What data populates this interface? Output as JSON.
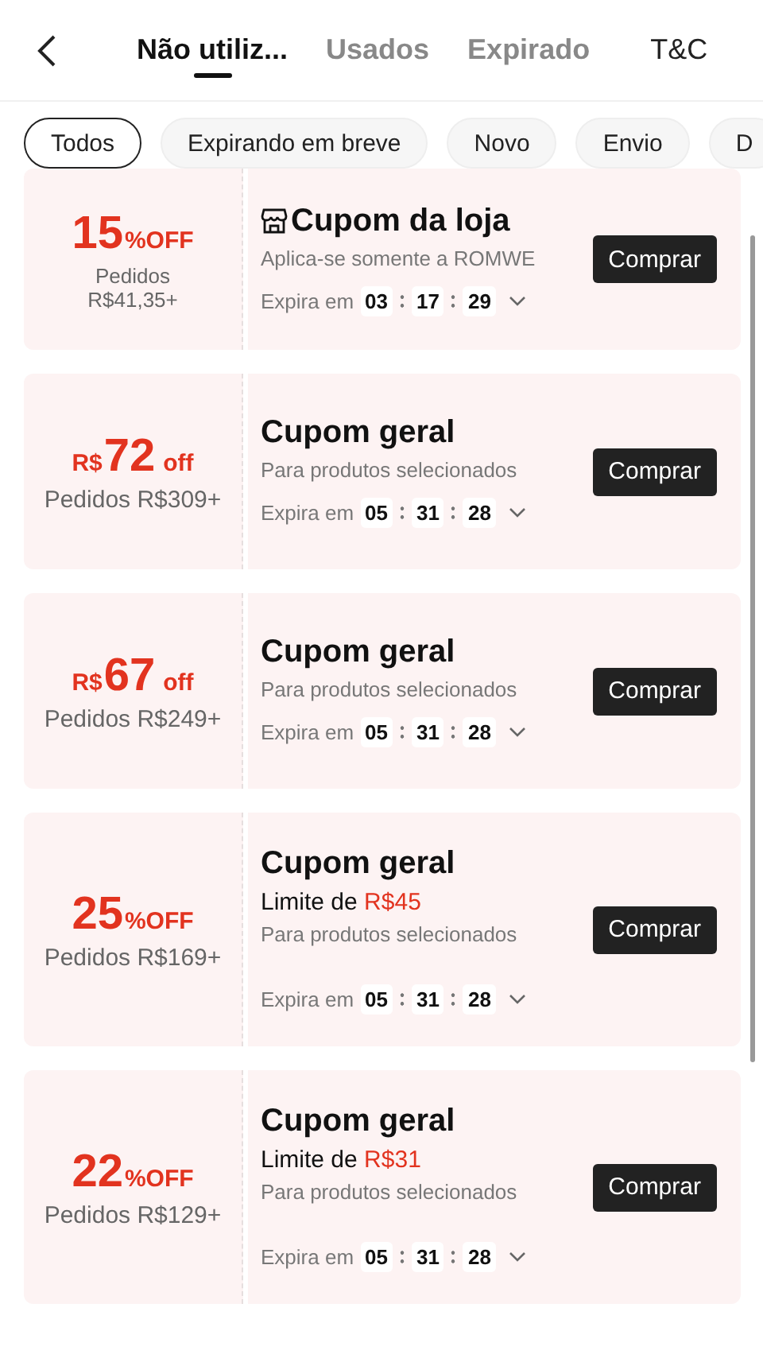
{
  "tabs": [
    {
      "label": "Não utiliz...",
      "selected": true
    },
    {
      "label": "Usados",
      "selected": false
    },
    {
      "label": "Expirado",
      "selected": false
    }
  ],
  "terms_link": "T&C",
  "filters": [
    {
      "label": "Todos",
      "selected": true
    },
    {
      "label": "Expirando em breve",
      "selected": false
    },
    {
      "label": "Novo",
      "selected": false
    },
    {
      "label": "Envio",
      "selected": false
    },
    {
      "label": "D",
      "selected": false
    }
  ],
  "coupons": [
    {
      "kind": "percent",
      "value": "15",
      "suffix": "%OFF",
      "min_order": [
        "Pedidos",
        "R$41,35+"
      ],
      "store_icon": true,
      "title": "Cupom da loja",
      "note": "Aplica-se somente a ROMWE",
      "expires_label": "Expira em",
      "timer": [
        "03",
        "17",
        "29"
      ],
      "button": "Comprar"
    },
    {
      "kind": "amount",
      "prefix": "R$",
      "value": "72",
      "suffix": "off",
      "min_order": [
        "Pedidos R$309+"
      ],
      "store_icon": false,
      "title": "Cupom geral",
      "note": "Para produtos selecionados",
      "expires_label": "Expira em",
      "timer": [
        "05",
        "31",
        "28"
      ],
      "button": "Comprar"
    },
    {
      "kind": "amount",
      "prefix": "R$",
      "value": "67",
      "suffix": "off",
      "min_order": [
        "Pedidos R$249+"
      ],
      "store_icon": false,
      "title": "Cupom geral",
      "note": "Para produtos selecionados",
      "expires_label": "Expira em",
      "timer": [
        "05",
        "31",
        "28"
      ],
      "button": "Comprar"
    },
    {
      "kind": "percent",
      "value": "25",
      "suffix": "%OFF",
      "min_order": [
        "Pedidos R$169+"
      ],
      "store_icon": false,
      "title": "Cupom geral",
      "limit": {
        "label": "Limite de",
        "amount": "R$45"
      },
      "note": "Para produtos selecionados",
      "expires_label": "Expira em",
      "timer": [
        "05",
        "31",
        "28"
      ],
      "button": "Comprar"
    },
    {
      "kind": "percent",
      "value": "22",
      "suffix": "%OFF",
      "min_order": [
        "Pedidos R$129+"
      ],
      "store_icon": false,
      "title": "Cupom geral",
      "limit": {
        "label": "Limite de",
        "amount": "R$31"
      },
      "note": "Para produtos selecionados",
      "expires_label": "Expira em",
      "timer": [
        "05",
        "31",
        "28"
      ],
      "button": "Comprar"
    }
  ]
}
